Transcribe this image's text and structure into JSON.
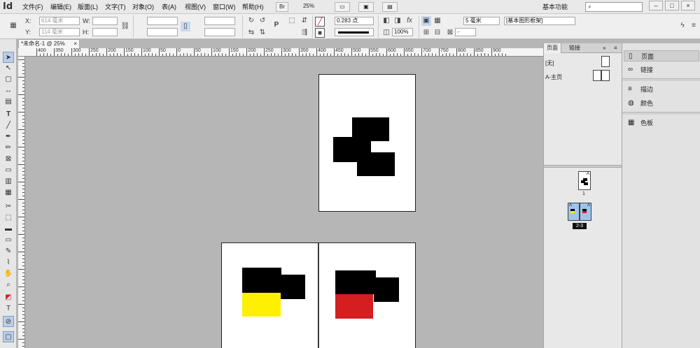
{
  "app": {
    "logo": "Id"
  },
  "menu": [
    "文件(F)",
    "编辑(E)",
    "版面(L)",
    "文字(T)",
    "对象(O)",
    "表(A)",
    "视图(V)",
    "窗口(W)",
    "帮助(H)"
  ],
  "menubar_controls": {
    "bridge": "Br",
    "zoom": "25%",
    "workspace": "基本功能",
    "win_min": "–",
    "win_max": "□",
    "win_close": "×"
  },
  "control": {
    "x_label": "X:",
    "x_value": "614 毫米",
    "y_label": "Y:",
    "y_value": "114 毫米",
    "w_label": "W:",
    "h_label": "H:",
    "stroke_weight": "0.283 点",
    "opacity": "100%",
    "spacing": "5 毫米",
    "object_style": "[基本图形框架]",
    "ref_label": "P"
  },
  "doc": {
    "tab_title": "*未命名-1 @ 25%",
    "tab_close": "×"
  },
  "ruler_labels": [
    "400",
    "350",
    "300",
    "250",
    "200",
    "150",
    "100",
    "50",
    "0",
    "50",
    "100",
    "150",
    "200",
    "250",
    "300",
    "350",
    "400",
    "450",
    "500",
    "550",
    "600",
    "650",
    "700",
    "750",
    "800",
    "850",
    "900"
  ],
  "pages_panel": {
    "tabs": [
      "页面",
      "链接"
    ],
    "expand": "»",
    "masters": [
      {
        "label": "[无]"
      },
      {
        "label": "A-主页"
      }
    ],
    "page1_label": "1",
    "page1_master": "A",
    "spread_label": "2-3",
    "spread_master": "A"
  },
  "dock": {
    "items": [
      {
        "label": "页面",
        "icon": "pages-icon"
      },
      {
        "label": "链接",
        "icon": "links-icon"
      },
      {
        "label": "描边",
        "icon": "stroke-icon"
      },
      {
        "label": "颜色",
        "icon": "color-icon"
      },
      {
        "label": "色板",
        "icon": "swatches-icon"
      }
    ]
  },
  "colors": {
    "yellow": "#ffef00",
    "red": "#d41e1f",
    "black": "#000000",
    "accent": "#b9cee7"
  }
}
